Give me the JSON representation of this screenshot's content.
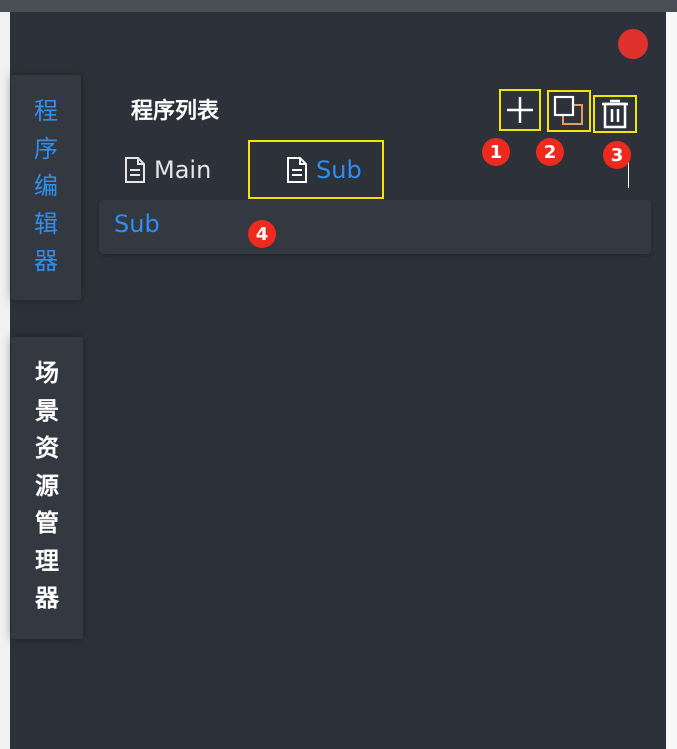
{
  "side_tabs": {
    "editor": {
      "chars": [
        "程",
        "序",
        "编",
        "辑",
        "器"
      ],
      "active": true
    },
    "scene": {
      "chars": [
        "场",
        "景",
        "资",
        "源",
        "管",
        "理",
        "器"
      ],
      "active": false
    }
  },
  "panel": {
    "title": "程序列表",
    "tabs": [
      {
        "label": "Main",
        "icon": "document-icon",
        "active": false
      },
      {
        "label": "Sub",
        "icon": "document-icon",
        "active": true
      }
    ],
    "toolbar": [
      {
        "icon": "plus-icon",
        "badge": "1"
      },
      {
        "icon": "copy-icon",
        "badge": "2"
      },
      {
        "icon": "trash-icon",
        "badge": "3"
      }
    ],
    "items": [
      {
        "label": "Sub",
        "badge": "4"
      }
    ]
  },
  "colors": {
    "accent": "#2f8ff0",
    "panel_bg": "#2d323a",
    "highlight": "#f5e400",
    "badge": "#ee2a1e",
    "close": "#e0322c"
  }
}
